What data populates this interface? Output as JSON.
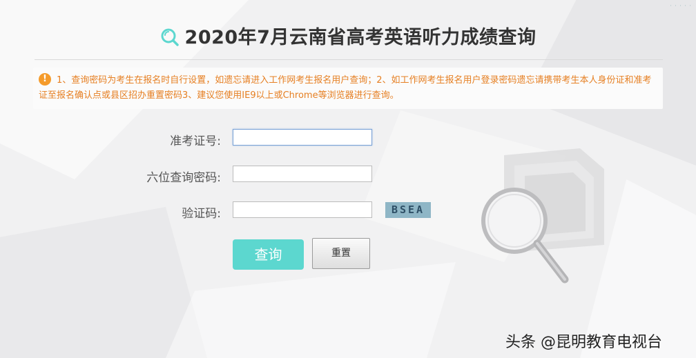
{
  "page": {
    "title": "2020年7月云南省高考英语听力成绩查询"
  },
  "notice": {
    "text": "1、查询密码为考生在报名时自行设置，如遗忘请进入工作网考生报名用户查询；2、如工作网考生报名用户登录密码遗忘请携带考生本人身份证和准考证至报名确认点或县区招办重置密码3、建议您使用IE9以上或Chrome等浏览器进行查询。",
    "icon": "warning-icon"
  },
  "form": {
    "exam_number_label": "准考证号:",
    "exam_number_value": "",
    "password_label": "六位查询密码:",
    "password_value": "",
    "captcha_label": "验证码:",
    "captcha_value": "",
    "captcha_code": "BSEA"
  },
  "buttons": {
    "query_label": "查询",
    "reset_label": "重置"
  },
  "watermark": {
    "text": "头条 @昆明教育电视台"
  },
  "colors": {
    "accent": "#5cd7cf",
    "notice_text": "#e67f22",
    "warning_icon": "#f59b2b",
    "captcha_bg": "#8fb6c6"
  }
}
